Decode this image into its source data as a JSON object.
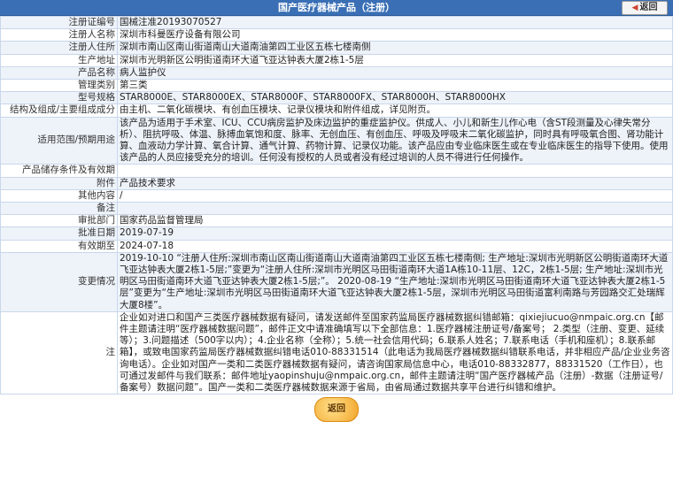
{
  "header": {
    "title": "国产医疗器械产品（注册）",
    "back_label": "返回"
  },
  "rows": [
    {
      "label": "注册证编号",
      "value": "国械注准20193070527"
    },
    {
      "label": "注册人名称",
      "value": "深圳市科曼医疗设备有限公司"
    },
    {
      "label": "注册人住所",
      "value": "深圳市南山区南山街道南山大道南油第四工业区五栋七楼南侧"
    },
    {
      "label": "生产地址",
      "value": "深圳市光明新区公明街道南环大道飞亚达钟表大厦2栋1-5层"
    },
    {
      "label": "产品名称",
      "value": "病人监护仪"
    },
    {
      "label": "管理类别",
      "value": "第三类"
    },
    {
      "label": "型号规格",
      "value": "STAR8000E、STAR8000EX、STAR8000F、STAR8000FX、STAR8000H、STAR8000HX"
    },
    {
      "label": "结构及组成/主要组成成分",
      "value": "由主机、二氧化碳模块、有创血压模块、记录仪模块和附件组成，详见附页。"
    },
    {
      "label": "适用范围/预期用途",
      "value": "该产品为适用于手术室、ICU、CCU病房监护及床边监护的重症监护仪。供成人、小儿和新生儿作心电（含ST段测量及心律失常分析）、阻抗呼吸、体温、脉搏血氧饱和度、脉率、无创血压、有创血压、呼吸及呼吸末二氧化碳监护，同时具有呼吸氧合图、肾功能计算、血液动力学计算、氧合计算、通气计算、药物计算、记录仪功能。该产品应由专业临床医生或在专业临床医生的指导下使用。使用该产品的人员应接受充分的培训。任何没有授权的人员或者没有经过培训的人员不得进行任何操作。"
    },
    {
      "label": "产品储存条件及有效期",
      "value": ""
    },
    {
      "label": "附件",
      "value": "产品技术要求"
    },
    {
      "label": "其他内容",
      "value": "/"
    },
    {
      "label": "备注",
      "value": ""
    },
    {
      "label": "审批部门",
      "value": "国家药品监督管理局"
    },
    {
      "label": "批准日期",
      "value": "2019-07-19"
    },
    {
      "label": "有效期至",
      "value": "2024-07-18"
    },
    {
      "label": "变更情况",
      "value": "2019-10-10 “注册人住所:深圳市南山区南山街道南山大道南油第四工业区五栋七楼南侧; 生产地址:深圳市光明新区公明街道南环大道飞亚达钟表大厦2栋1-5层;”变更为“注册人住所:深圳市光明区马田街道南环大道1A栋10-11层、12C，2栋1-5层; 生产地址:深圳市光明区马田街道南环大道飞亚达钟表大厦2栋1-5层;”。 2020-08-19 “生产地址:深圳市光明区马田街道南环大道飞亚达钟表大厦2栋1-5层”变更为“生产地址:深圳市光明区马田街道南环大道飞亚达钟表大厦2栋1-5层，深圳市光明区马田街道富利南路与芳园路交汇处瑞辉大厦8楼”。"
    },
    {
      "label": "注",
      "value": "企业如对进口和国产三类医疗器械数据有疑问，请发送邮件至国家药监局医疗器械数据纠错邮箱：qixiejiucuo@nmpaic.org.cn【邮件主题请注明“医疗器械数据问题”，邮件正文中请准确填写以下全部信息：1.医疗器械注册证号/备案号； 2.类型（注册、变更、延续等）；3.问题描述（500字以内）；4.企业名称（全称）；5.统一社会信用代码；6.联系人姓名；7.联系电话（手机和座机）；8.联系邮箱】，或致电国家药监局医疗器械数据纠错电话010-88331514（此电话为我局医疗器械数据纠错联系电话，并非相应产品/企业业务咨询电话）。企业如对国产一类和二类医疗器械数据有疑问，请咨询国家局信息中心，电话010-88332877，88331520（工作日），也可通过发邮件与我们联系：邮件地址yaopinshuju@nmpaic.org.cn，邮件主题请注明“国产医疗器械产品（注册）-数据（注册证号/备案号）数据问题”。国产一类和二类医疗器械数据来源于省局，由省局通过数据共享平台进行纠错和维护。"
    }
  ],
  "footer": {
    "return_label": "返回"
  }
}
